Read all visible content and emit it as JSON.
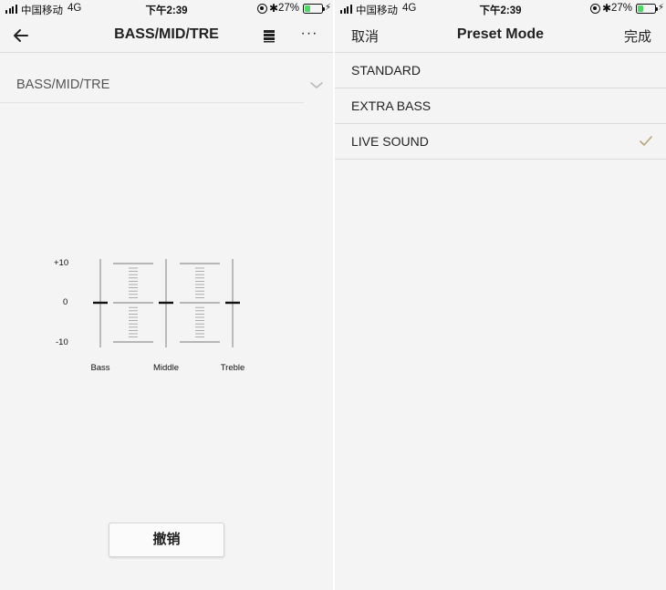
{
  "status_left": {
    "carrier": "中国移动",
    "network": "4G",
    "time": "下午2:39",
    "battery": "27%"
  },
  "status_right": {
    "carrier": "中国移动",
    "network": "4G",
    "time": "下午2:39",
    "battery": "27%"
  },
  "eq_screen": {
    "title": "BASS/MID/TRE",
    "dropdown_value": "BASS/MID/TRE",
    "scale": {
      "top": "+10",
      "middle": "0",
      "bottom": "-10"
    },
    "bands": [
      {
        "label": "Bass",
        "value": 0
      },
      {
        "label": "Middle",
        "value": 0
      },
      {
        "label": "Treble",
        "value": 0
      }
    ],
    "undo_label": "撤销",
    "icons": [
      "back-arrow-icon",
      "list-icon",
      "more-icon",
      "chevron-down-icon"
    ]
  },
  "preset_screen": {
    "title": "Preset Mode",
    "cancel_label": "取消",
    "done_label": "完成",
    "items": [
      {
        "label": "STANDARD",
        "selected": false
      },
      {
        "label": "EXTRA BASS",
        "selected": false
      },
      {
        "label": "LIVE SOUND",
        "selected": true
      }
    ],
    "check_color": "#b8a47a"
  }
}
